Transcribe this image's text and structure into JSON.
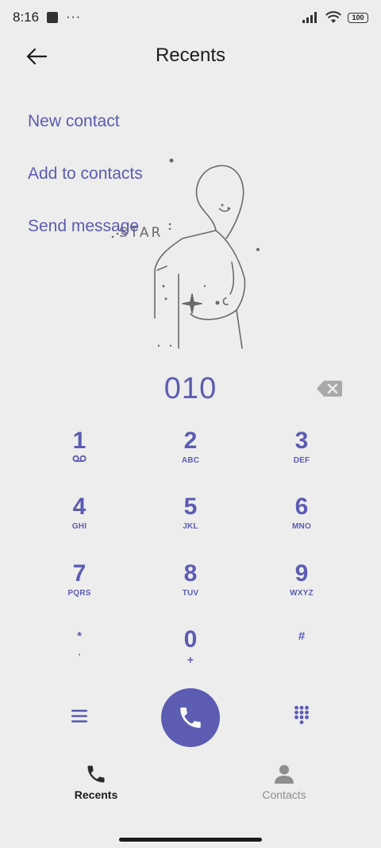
{
  "status_bar": {
    "time": "8:16",
    "dots": "···",
    "battery": "100"
  },
  "header": {
    "title": "Recents",
    "back_icon": "arrow-left-icon"
  },
  "actions": {
    "new_contact": "New contact",
    "add_to_contacts": "Add to contacts",
    "send_message": "Send message"
  },
  "illustration": {
    "text": "STAR"
  },
  "dialer": {
    "number": "010"
  },
  "keypad": {
    "k1": {
      "digit": "1"
    },
    "k2": {
      "digit": "2",
      "letters": "ABC"
    },
    "k3": {
      "digit": "3",
      "letters": "DEF"
    },
    "k4": {
      "digit": "4",
      "letters": "GHI"
    },
    "k5": {
      "digit": "5",
      "letters": "JKL"
    },
    "k6": {
      "digit": "6",
      "letters": "MNO"
    },
    "k7": {
      "digit": "7",
      "letters": "PQRS"
    },
    "k8": {
      "digit": "8",
      "letters": "TUV"
    },
    "k9": {
      "digit": "9",
      "letters": "WXYZ"
    },
    "kstar": {
      "digit": "*",
      "letters": ","
    },
    "k0": {
      "digit": "0",
      "letters": "+"
    },
    "khash": {
      "digit": "#"
    }
  },
  "tabs": {
    "recents": "Recents",
    "contacts": "Contacts"
  },
  "colors": {
    "accent": "#5b5cb2",
    "background": "#ededed",
    "inactive": "#8e8e8e"
  }
}
